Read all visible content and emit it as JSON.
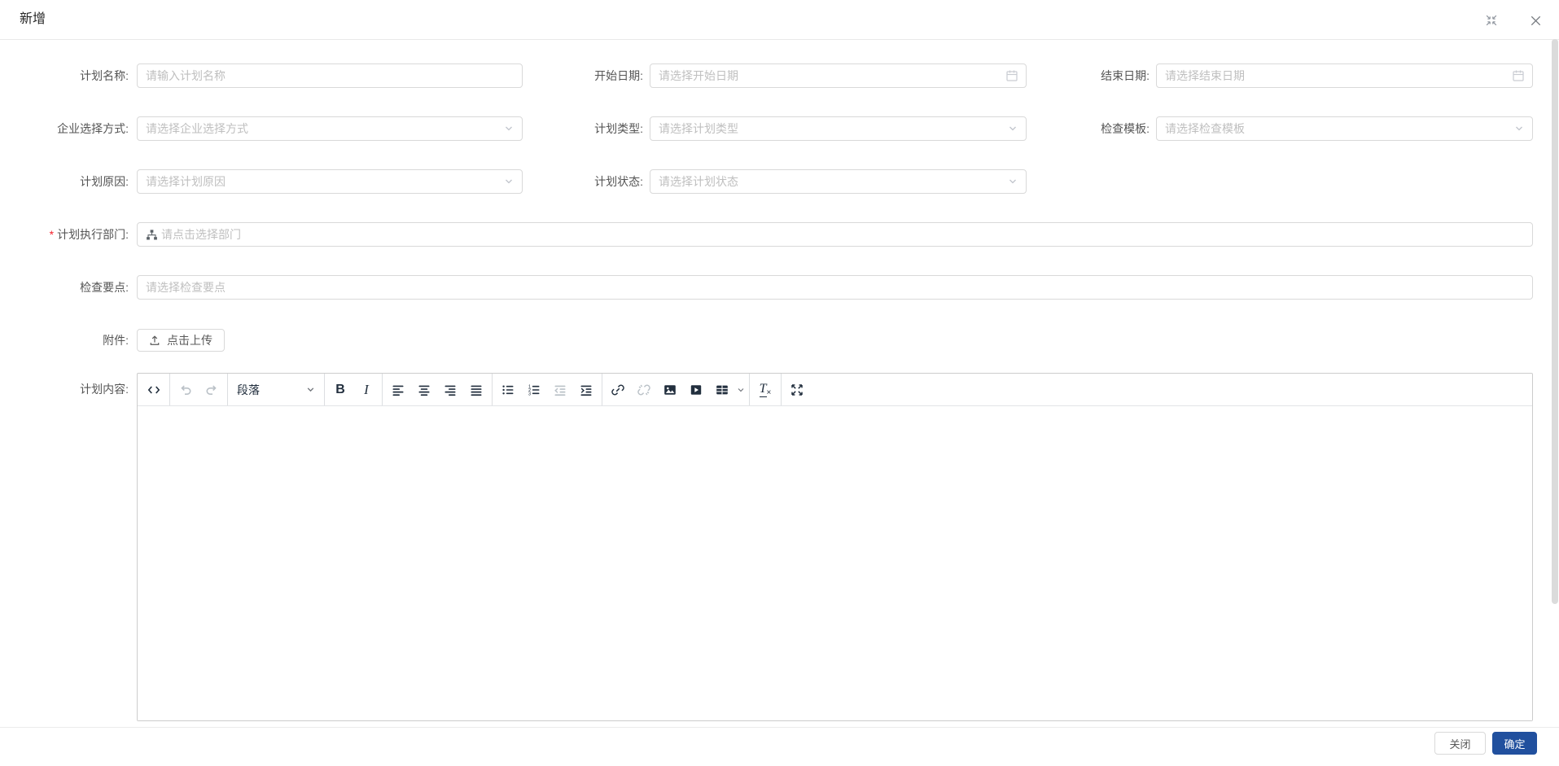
{
  "dialog": {
    "title": "新增"
  },
  "window_controls": {
    "compress_icon": "exit-fullscreen",
    "close_icon": "close"
  },
  "form": {
    "plan_name": {
      "label": "计划名称:",
      "placeholder": "请输入计划名称"
    },
    "start_date": {
      "label": "开始日期:",
      "placeholder": "请选择开始日期"
    },
    "end_date": {
      "label": "结束日期:",
      "placeholder": "请选择结束日期"
    },
    "enterprise_select_mode": {
      "label": "企业选择方式:",
      "placeholder": "请选择企业选择方式"
    },
    "plan_type": {
      "label": "计划类型:",
      "placeholder": "请选择计划类型"
    },
    "check_template": {
      "label": "检查模板:",
      "placeholder": "请选择检查模板"
    },
    "plan_reason": {
      "label": "计划原因:",
      "placeholder": "请选择计划原因"
    },
    "plan_status": {
      "label": "计划状态:",
      "placeholder": "请选择计划状态"
    },
    "exec_department": {
      "required_mark": "*",
      "label": "计划执行部门:",
      "placeholder": "请点击选择部门"
    },
    "check_points": {
      "label": "检查要点:",
      "placeholder": "请选择检查要点"
    },
    "attachment": {
      "label": "附件:",
      "upload_label": "点击上传"
    },
    "plan_content": {
      "label": "计划内容:"
    }
  },
  "editor": {
    "paragraph_label": "段落",
    "toolbar": [
      {
        "name": "source-code",
        "enabled": true
      },
      {
        "name": "undo",
        "enabled": false
      },
      {
        "name": "redo",
        "enabled": false
      },
      {
        "name": "paragraph-format",
        "enabled": true
      },
      {
        "name": "bold",
        "enabled": true
      },
      {
        "name": "italic",
        "enabled": true
      },
      {
        "name": "align-left",
        "enabled": true
      },
      {
        "name": "align-center",
        "enabled": true
      },
      {
        "name": "align-right",
        "enabled": true
      },
      {
        "name": "align-justify",
        "enabled": true
      },
      {
        "name": "bullet-list",
        "enabled": true
      },
      {
        "name": "numbered-list",
        "enabled": true
      },
      {
        "name": "outdent",
        "enabled": false
      },
      {
        "name": "indent",
        "enabled": true
      },
      {
        "name": "link",
        "enabled": true
      },
      {
        "name": "unlink",
        "enabled": false
      },
      {
        "name": "image",
        "enabled": true
      },
      {
        "name": "media",
        "enabled": true
      },
      {
        "name": "table",
        "enabled": true
      },
      {
        "name": "remove-format",
        "enabled": true
      },
      {
        "name": "fullscreen",
        "enabled": true
      }
    ]
  },
  "footer": {
    "close_label": "关闭",
    "confirm_label": "确定"
  },
  "colors": {
    "primary": "#21509e",
    "required": "#f5222d",
    "input_border": "#d9d9d9",
    "placeholder": "#bfbfbf",
    "label_text": "#555555",
    "toolbar_icon": "#222f3e",
    "toolbar_icon_disabled": "#bac1c7"
  }
}
